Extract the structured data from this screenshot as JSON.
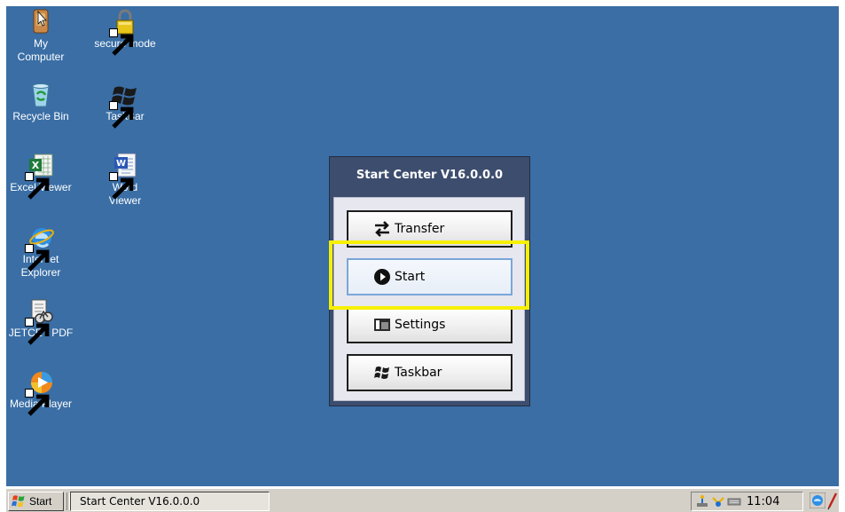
{
  "desktop": {
    "background": "#3a6ea5",
    "icons": [
      {
        "label": "My\nComputer",
        "icon": "my-computer-icon"
      },
      {
        "label": "secure mode",
        "icon": "padlock-icon"
      },
      {
        "label": "Recycle Bin",
        "icon": "recycle-bin-icon"
      },
      {
        "label": "TaskBar",
        "icon": "windows-flag-icon"
      },
      {
        "label": "Excel Viewer",
        "icon": "excel-icon"
      },
      {
        "label": "Word\nViewer",
        "icon": "word-icon"
      },
      {
        "label": "Internet\nExplorer",
        "icon": "internet-explorer-icon"
      },
      {
        "label": "JETCET PDF",
        "icon": "jetcet-pdf-icon"
      },
      {
        "label": "Media Player",
        "icon": "media-player-icon"
      }
    ]
  },
  "start_center": {
    "title": "Start Center V16.0.0.0",
    "buttons": [
      {
        "label": "Transfer",
        "icon": "transfer-arrows-icon"
      },
      {
        "label": "Start",
        "icon": "play-circle-icon",
        "selected": true
      },
      {
        "label": "Settings",
        "icon": "settings-icon"
      },
      {
        "label": "Taskbar",
        "icon": "windows-flag-icon"
      }
    ],
    "highlight_color": "#f7f000"
  },
  "taskbar": {
    "start_label": "Start",
    "task_button_label": "Start Center V16.0.0.0",
    "clock": "11:04",
    "tray_icons": [
      "network-icon",
      "usb-icon",
      "keyboard-icon"
    ]
  }
}
